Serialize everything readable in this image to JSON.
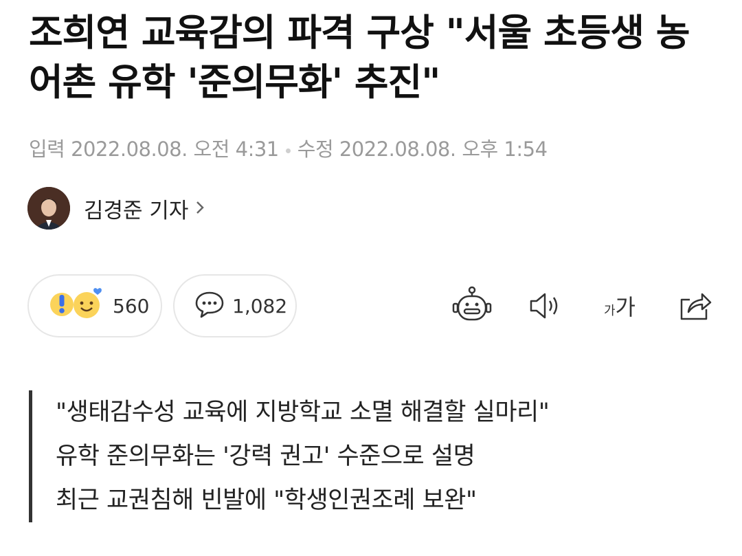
{
  "article": {
    "headline": "조희연 교육감의 파격 구상 \"서울 초등생 농어촌 유학 '준의무화' 추진\"",
    "published": "입력 2022.08.08. 오전 4:31",
    "modified": "수정 2022.08.08. 오후 1:54",
    "reporter": "김경준 기자"
  },
  "reactions": {
    "count": "560",
    "icon": "emoji-reaction-icons"
  },
  "comments": {
    "count": "1,082",
    "icon": "speech-bubble-icon"
  },
  "toolbar": {
    "icons": [
      "robot-summary-icon",
      "speaker-icon",
      "font-size-icon",
      "share-icon"
    ],
    "font_size_label_small": "가",
    "font_size_label_large": "가"
  },
  "summary": [
    "\"생태감수성 교육에 지방학교 소멸 해결할 실마리\"",
    "유학 준의무화는 '강력 권고' 수준으로 설명",
    "최근 교권침해 빈발에 \"학생인권조례 보완\""
  ],
  "colors": {
    "text": "#111111",
    "meta": "#9a9a9a",
    "border": "#e6e6e6"
  }
}
